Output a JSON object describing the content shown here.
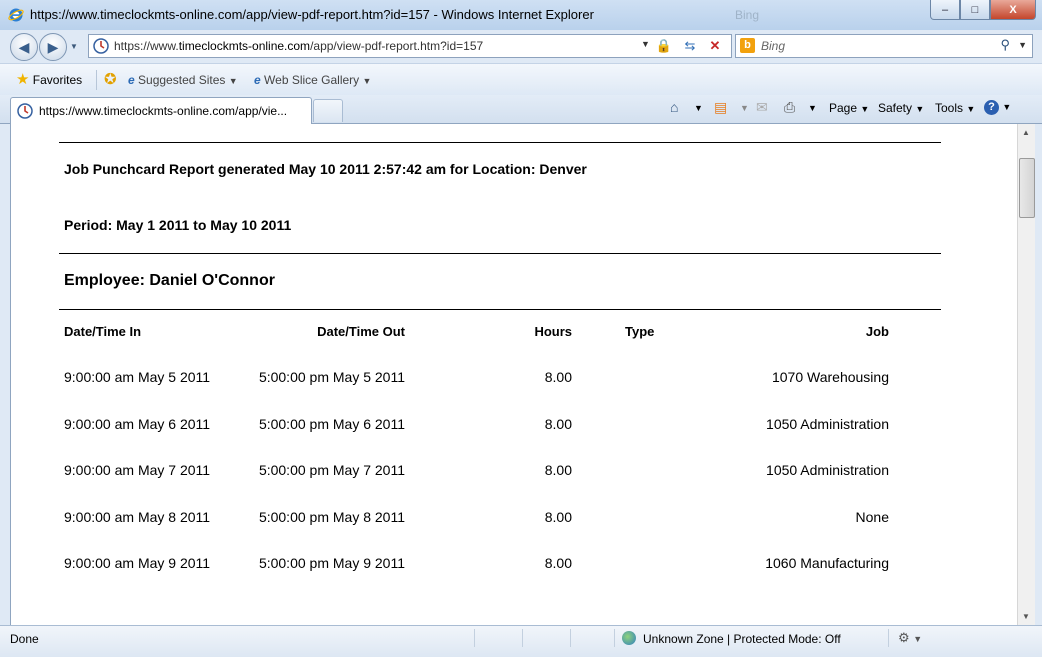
{
  "window": {
    "title": "https://www.timeclockmts-online.com/app/view-pdf-report.htm?id=157 - Windows Internet Explorer",
    "ghost_text": "Bing",
    "min_label": "‒",
    "max_label": "□",
    "close_label": "X"
  },
  "address": {
    "url_prefix": "https://www.",
    "url_domain": "timeclockmts-online.com",
    "url_path": "/app/view-pdf-report.htm?id=157"
  },
  "search": {
    "placeholder": "Bing"
  },
  "favorites_bar": {
    "favorites_label": "Favorites",
    "suggested_label": "Suggested Sites",
    "webslice_label": "Web Slice Gallery"
  },
  "tab": {
    "title": "https://www.timeclockmts-online.com/app/vie..."
  },
  "commands": {
    "page": "Page",
    "safety": "Safety",
    "tools": "Tools"
  },
  "report": {
    "heading": "Job Punchcard Report generated May 10 2011 2:57:42 am for Location: Denver",
    "period": "Period: May 1 2011 to May 10 2011",
    "employee": "Employee: Daniel O'Connor",
    "columns": {
      "in": "Date/Time In",
      "out": "Date/Time Out",
      "hours": "Hours",
      "type": "Type",
      "job": "Job"
    },
    "rows": [
      {
        "in": "9:00:00 am May 5 2011",
        "out": "5:00:00 pm May 5 2011",
        "hours": "8.00",
        "type": "",
        "job": "1070 Warehousing"
      },
      {
        "in": "9:00:00 am May 6 2011",
        "out": "5:00:00 pm May 6 2011",
        "hours": "8.00",
        "type": "",
        "job": "1050 Administration"
      },
      {
        "in": "9:00:00 am May 7 2011",
        "out": "5:00:00 pm May 7 2011",
        "hours": "8.00",
        "type": "",
        "job": "1050 Administration"
      },
      {
        "in": "9:00:00 am May 8 2011",
        "out": "5:00:00 pm May 8 2011",
        "hours": "8.00",
        "type": "",
        "job": "None"
      },
      {
        "in": "9:00:00 am May 9 2011",
        "out": "5:00:00 pm May 9 2011",
        "hours": "8.00",
        "type": "",
        "job": "1060 Manufacturing"
      }
    ]
  },
  "status": {
    "text": "Done",
    "zone": "Unknown Zone | Protected Mode: Off"
  }
}
